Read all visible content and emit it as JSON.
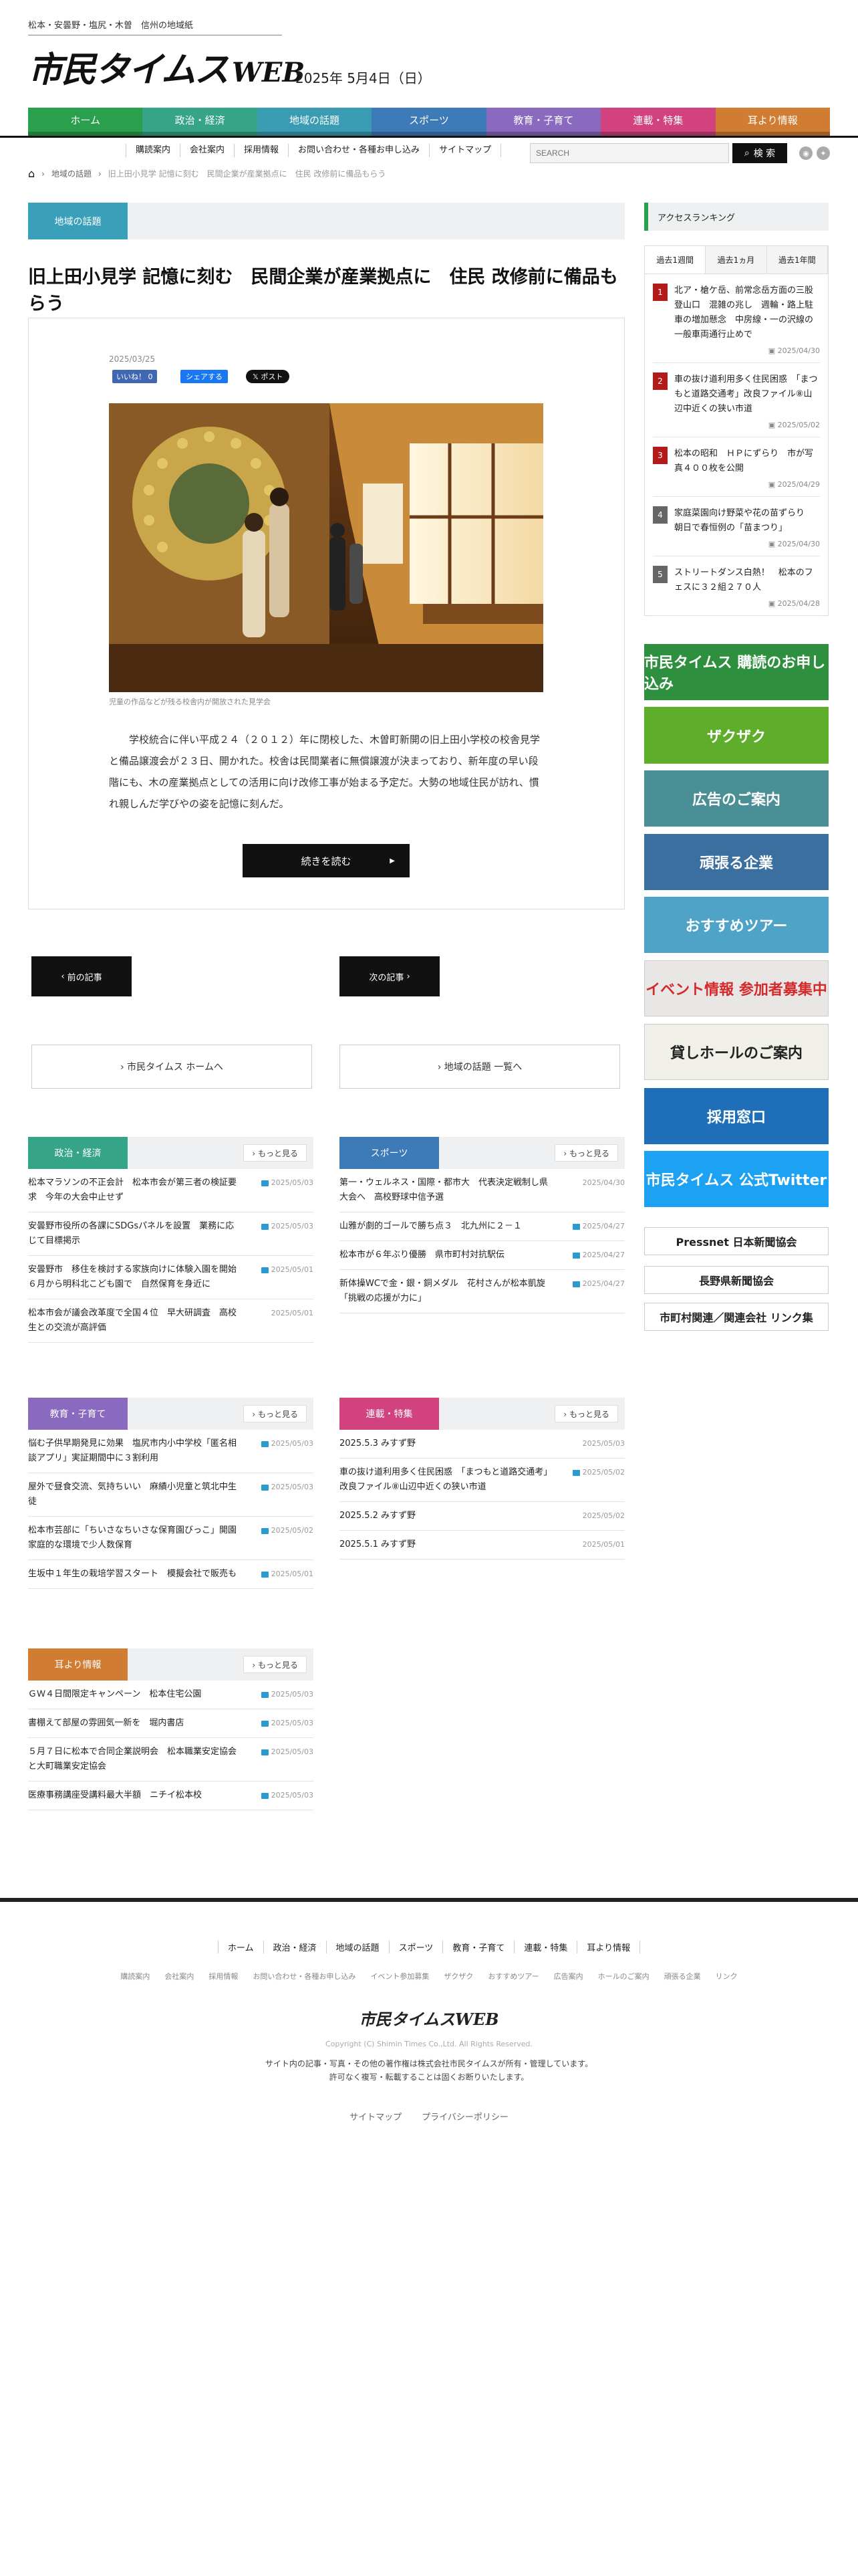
{
  "header": {
    "tagline": "松本・安曇野・塩尻・木曽　信州の地域紙",
    "logo": "市民タイムス",
    "logo_suffix": "WEB",
    "date": "2025年 5月4日（日）"
  },
  "nav": [
    {
      "label": "ホーム",
      "color": "#2aa04e"
    },
    {
      "label": "政治・経済",
      "color": "#35a487"
    },
    {
      "label": "地域の話題",
      "color": "#3a9cb3"
    },
    {
      "label": "スポーツ",
      "color": "#3d7ab8"
    },
    {
      "label": "教育・子育て",
      "color": "#8a6abf"
    },
    {
      "label": "連載・特集",
      "color": "#d2427e"
    },
    {
      "label": "耳より情報",
      "color": "#d07c33"
    }
  ],
  "subnav": [
    "購読案内",
    "会社案内",
    "採用情報",
    "お問い合わせ・各種お申し込み",
    "サイトマップ"
  ],
  "search": {
    "placeholder": "SEARCH",
    "button": "検 索"
  },
  "breadcrumb": [
    "地域の話題",
    "旧上田小見学 記憶に刻む　民間企業が産業拠点に　住民 改修前に備品もらう"
  ],
  "section_label": "地域の話題",
  "article": {
    "title": "旧上田小見学 記憶に刻む　民間企業が産業拠点に　住民 改修前に備品もらう",
    "date": "2025/03/25",
    "fb_like": "いいね！ 0",
    "fb_share": "シェアする",
    "x_post": "𝕏 ポスト",
    "caption": "児童の作品などが残る校舎内が開放された見学会",
    "body": "学校統合に伴い平成２４（２０１２）年に閉校した、木曽町新開の旧上田小学校の校舎見学と備品譲渡会が２３日、開かれた。校舎は民間業者に無償譲渡が決まっており、新年度の早い段階にも、木の産業拠点としての活用に向け改修工事が始まる予定だ。大勢の地域住民が訪れ、慣れ親しんだ学びやの姿を記憶に刻んだ。",
    "read_more": "続きを読む"
  },
  "pager": {
    "prev": "前の記事",
    "next": "次の記事"
  },
  "bottom_links": {
    "home": "› 市民タイムス ホームへ",
    "list": "› 地域の話題 一覧へ"
  },
  "more_label": "› もっと見る",
  "categories": [
    {
      "label": "政治・経済",
      "color": "#35a487",
      "items": [
        {
          "title": "松本マラソンの不正会計　松本市会が第三者の検証要求　今年の大会中止せず",
          "date": "2025/05/03",
          "icon": true
        },
        {
          "title": "安曇野市役所の各課にSDGsパネルを設置　業務に応じて目標掲示",
          "date": "2025/05/03",
          "icon": true
        },
        {
          "title": "安曇野市　移住を検討する家族向けに体験入園を開始　６月から明科北こども園で　自然保育を身近に",
          "date": "2025/05/01",
          "icon": true
        },
        {
          "title": "松本市会が議会改革度で全国４位　早大研調査　高校生との交流が高評価",
          "date": "2025/05/01",
          "icon": false
        }
      ]
    },
    {
      "label": "スポーツ",
      "color": "#3d7ab8",
      "items": [
        {
          "title": "第一・ウェルネス・国際・都市大　代表決定戦制し県大会へ　高校野球中信予選",
          "date": "2025/04/30",
          "icon": false
        },
        {
          "title": "山雅が劇的ゴールで勝ち点３　北九州に２－１",
          "date": "2025/04/27",
          "icon": true
        },
        {
          "title": "松本市が６年ぶり優勝　県市町村対抗駅伝",
          "date": "2025/04/27",
          "icon": true
        },
        {
          "title": "新体操WCで金・銀・銅メダル　花村さんが松本凱旋「挑戦の応援が力に」",
          "date": "2025/04/27",
          "icon": true
        }
      ]
    },
    {
      "label": "教育・子育て",
      "color": "#8a6abf",
      "items": [
        {
          "title": "悩む子供早期発見に効果　塩尻市内小中学校「匿名相談アプリ」実証期間中に３割利用",
          "date": "2025/05/03",
          "icon": true
        },
        {
          "title": "屋外で昼食交流、気持ちいい　麻績小児童と筑北中生徒",
          "date": "2025/05/03",
          "icon": true
        },
        {
          "title": "松本市芸部に「ちいさなちいさな保育園びっこ」開園　家庭的な環境で少人数保育",
          "date": "2025/05/02",
          "icon": true
        },
        {
          "title": "生坂中１年生の栽培学習スタート　模擬会社で販売も",
          "date": "2025/05/01",
          "icon": true
        }
      ]
    },
    {
      "label": "連載・特集",
      "color": "#d2427e",
      "items": [
        {
          "title": "2025.5.3 みすず野",
          "date": "2025/05/03",
          "icon": false
        },
        {
          "title": "車の抜け道利用多く住民困惑　「まつもと道路交通考」改良ファイル⑧山辺中近くの狭い市道",
          "date": "2025/05/02",
          "icon": true
        },
        {
          "title": "2025.5.2 みすず野",
          "date": "2025/05/02",
          "icon": false
        },
        {
          "title": "2025.5.1 みすず野",
          "date": "2025/05/01",
          "icon": false
        }
      ]
    },
    {
      "label": "耳より情報",
      "color": "#d07c33",
      "items": [
        {
          "title": "ＧＷ４日間限定キャンペーン　松本住宅公園",
          "date": "2025/05/03",
          "icon": true
        },
        {
          "title": "書棚えて部屋の雰囲気一新を　堀内書店",
          "date": "2025/05/03",
          "icon": true
        },
        {
          "title": "５月７日に松本で合同企業説明会　松本職業安定協会と大町職業安定協会",
          "date": "2025/05/03",
          "icon": true
        },
        {
          "title": "医療事務講座受講料最大半額　ニチイ松本校",
          "date": "2025/05/03",
          "icon": true
        }
      ]
    }
  ],
  "sidebar": {
    "ranking_title": "アクセスランキング",
    "tabs": [
      "過去1週間",
      "過去1ヵ月",
      "過去1年間"
    ],
    "ranking": [
      {
        "rank": "1",
        "title": "北ア・槍ケ岳、前常念岳方面の三股登山口　混雑の兆し　週輪・路上駐車の増加懸念　中房線・一の沢線の一般車両通行止めで",
        "date": "2025/04/30",
        "color": "#b41a1a"
      },
      {
        "rank": "2",
        "title": "車の抜け道利用多く住民困惑　「まつもと道路交通考」改良ファイル⑧山辺中近くの狭い市道",
        "date": "2025/05/02",
        "color": "#b41a1a"
      },
      {
        "rank": "3",
        "title": "松本の昭和　ＨＰにずらり　市が写真４００枚を公開",
        "date": "2025/04/29",
        "color": "#b41a1a"
      },
      {
        "rank": "4",
        "title": "家庭菜園向け野菜や花の苗ずらり　朝日で春恒例の「苗まつり」",
        "date": "2025/04/30",
        "color": "#666"
      },
      {
        "rank": "5",
        "title": "ストリートダンス白熱！　松本のフェスに３２組２７０人",
        "date": "2025/04/28",
        "color": "#666"
      }
    ],
    "banners": [
      {
        "text": "市民タイムス 購読のお申し込み",
        "color": "#2e8f3e"
      },
      {
        "text": "ザクザク",
        "color": "#5fae2b"
      },
      {
        "text": "広告のご案内",
        "color": "#4b8f96"
      },
      {
        "text": "頑張る企業",
        "color": "#3a6fa0"
      },
      {
        "text": "おすすめツアー",
        "color": "#4fa3c7"
      },
      {
        "text": "イベント情報 参加者募集中",
        "color": "#e9e6e6"
      },
      {
        "text": "貸しホールのご案内",
        "color": "#f0efe8"
      },
      {
        "text": "採用窓口",
        "color": "#1f6fb8"
      },
      {
        "text": "市民タイムス 公式Twitter",
        "color": "#1da1f2"
      },
      {
        "text": "Pressnet 日本新聞協会",
        "color": "#ffffff"
      },
      {
        "text": "長野県新聞協会",
        "color": "#ffffff"
      },
      {
        "text": "市町村関連／関連会社 リンク集",
        "color": "#ffffff"
      }
    ]
  },
  "footer": {
    "nav": [
      "ホーム",
      "政治・経済",
      "地域の話題",
      "スポーツ",
      "教育・子育て",
      "連載・特集",
      "耳より情報"
    ],
    "links": [
      "購読案内",
      "会社案内",
      "採用情報",
      "お問い合わせ・各種お申し込み",
      "イベント参加募集",
      "ザクザク",
      "おすすめツアー",
      "広告案内",
      "ホールのご案内",
      "頑張る企業",
      "リンク"
    ],
    "logo": "市民タイムスWEB",
    "copyright": "Copyright (C) Shimin Times Co.,Ltd. All Rights Reserved.",
    "notice1": "サイト内の記事・写真・その他の著作権は株式会社市民タイムスが所有・管理しています。",
    "notice2": "許可なく複写・転載することは固くお断りいたします。",
    "sub": [
      "サイトマップ",
      "プライバシーポリシー"
    ]
  }
}
